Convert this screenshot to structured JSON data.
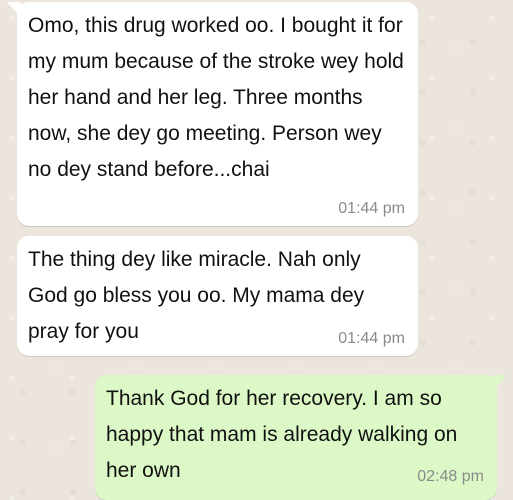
{
  "theme": {
    "wallpaper": "#ece5dd",
    "incoming_bubble": "#ffffff",
    "outgoing_bubble": "#dcf8c6",
    "timestamp_color": "#8a8a8a"
  },
  "messages": [
    {
      "direction": "incoming",
      "text": " Omo, this drug worked oo. I bought it for my mum because of the stroke wey hold her hand and her leg. Three months now, she dey go meeting. Person wey no dey stand before...chai",
      "time": "01:44 pm"
    },
    {
      "direction": "incoming",
      "text": " The thing dey like miracle. Nah only God go bless you oo. My mama dey pray for you",
      "time": "01:44 pm"
    },
    {
      "direction": "outgoing",
      "text": " Thank God for her recovery. I am so happy that mam is already walking on her own",
      "time": "02:48 pm"
    }
  ]
}
